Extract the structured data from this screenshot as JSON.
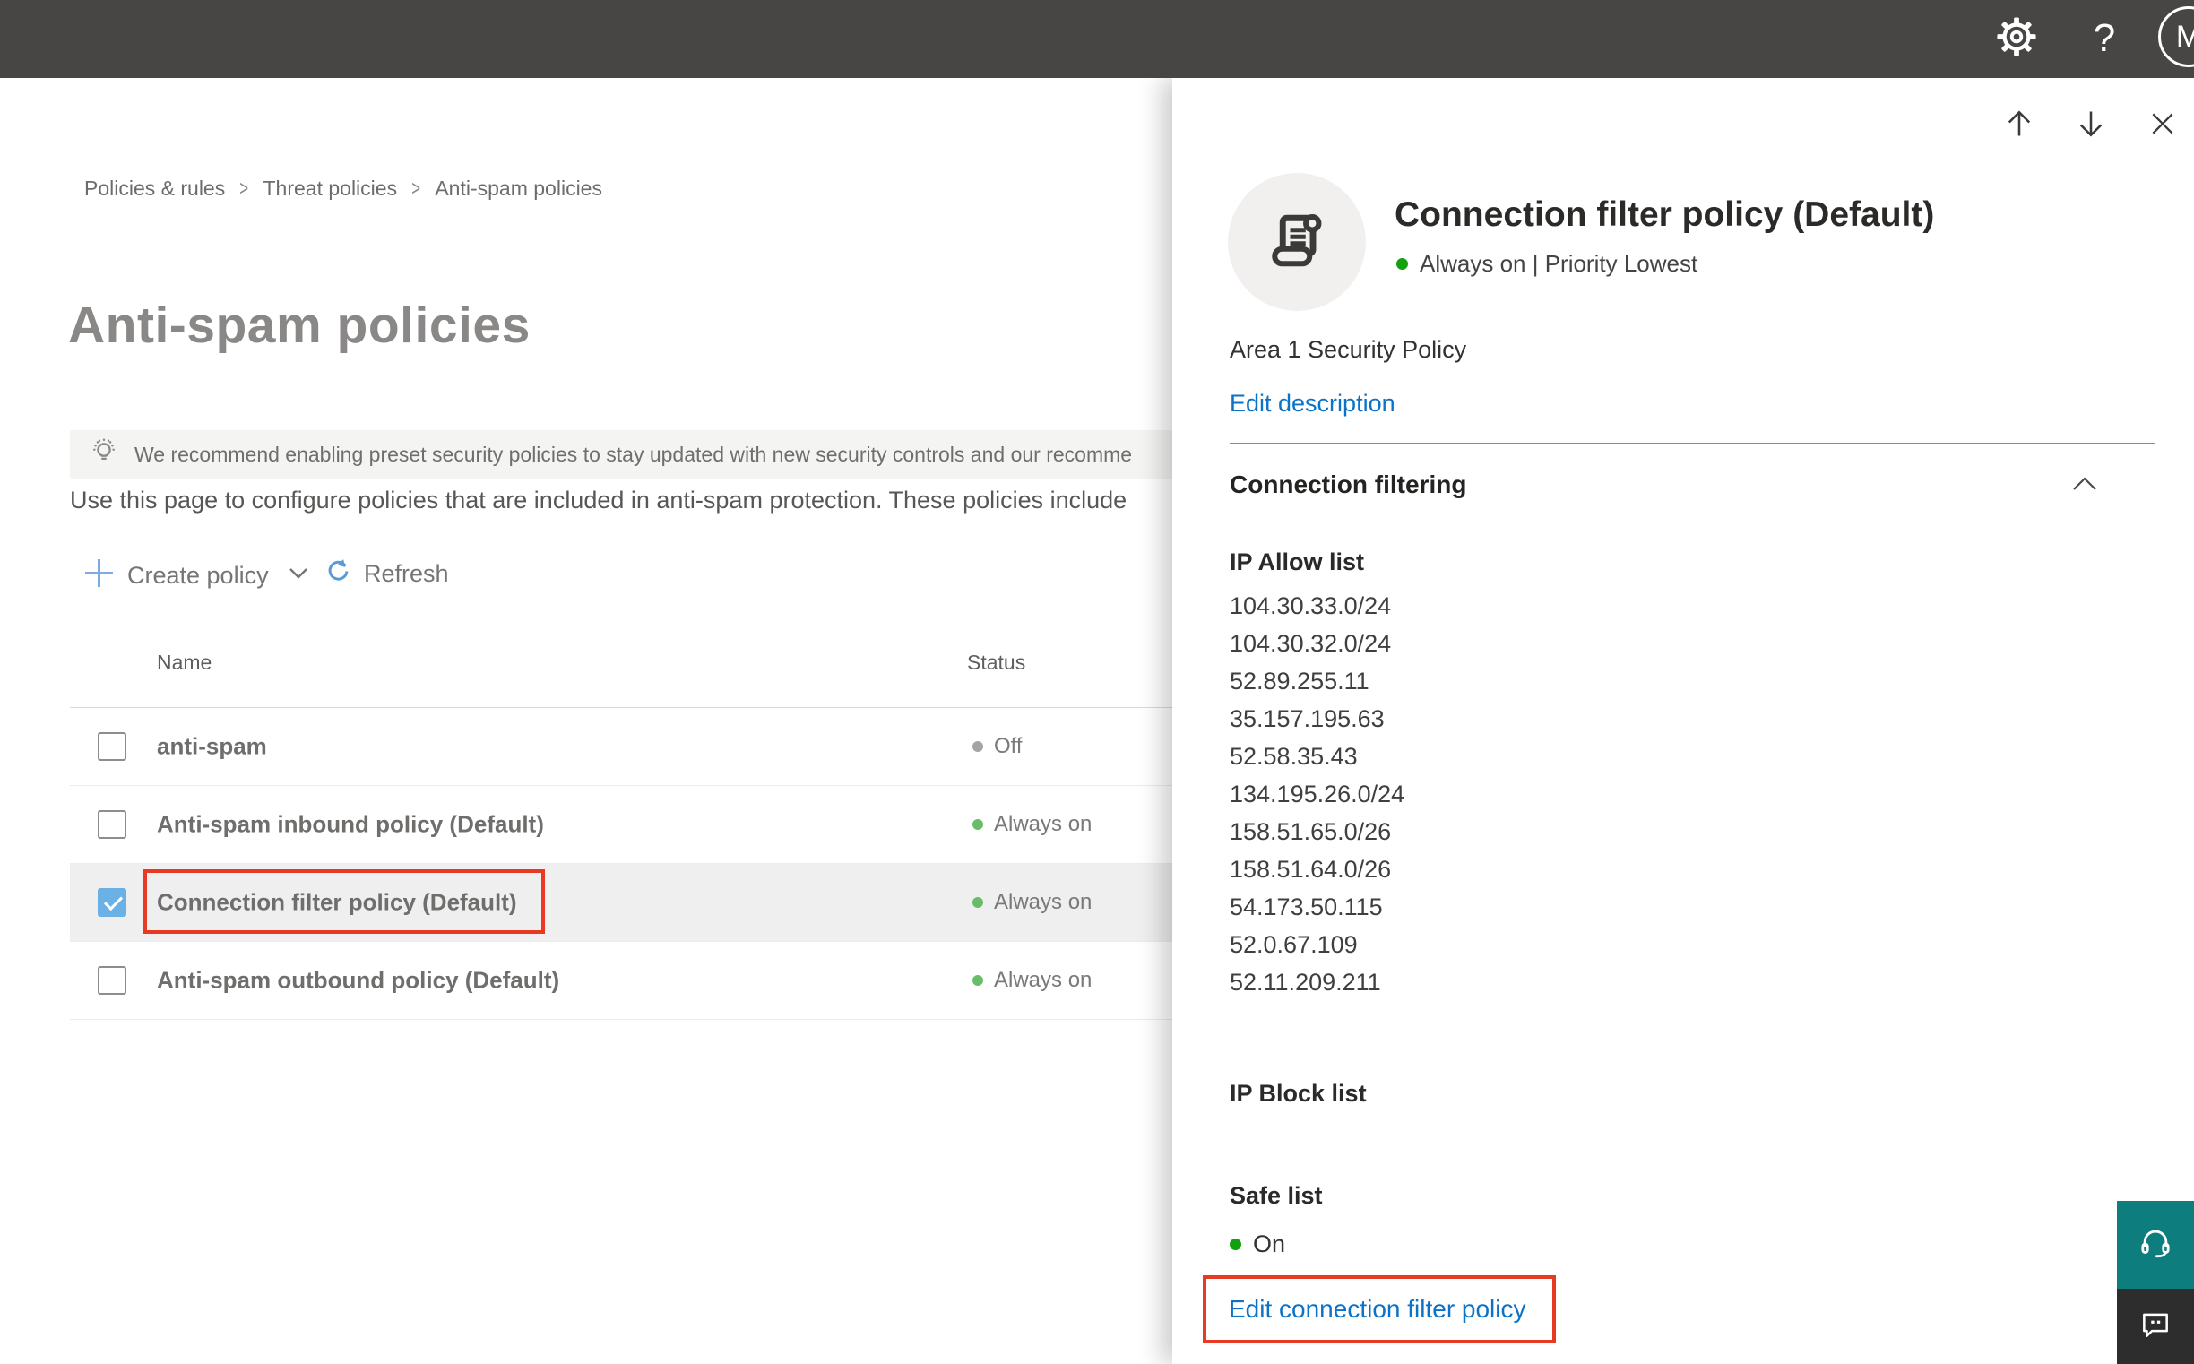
{
  "topbar": {
    "help_label": "?",
    "avatar_initial": "M"
  },
  "breadcrumb": {
    "separator": ">",
    "items": [
      "Policies & rules",
      "Threat policies",
      "Anti-spam policies"
    ]
  },
  "page": {
    "title": "Anti-spam policies",
    "banner_text": "We recommend enabling preset security policies to stay updated with new security controls and our recomme",
    "description": "Use this page to configure policies that are included in anti-spam protection. These policies include",
    "create_policy_label": "Create policy",
    "refresh_label": "Refresh"
  },
  "table": {
    "columns": [
      "Name",
      "Status"
    ],
    "rows": [
      {
        "name": "anti-spam",
        "status_label": "Off",
        "status": "off",
        "checked": false,
        "selected": false,
        "highlighted": false
      },
      {
        "name": "Anti-spam inbound policy (Default)",
        "status_label": "Always on",
        "status": "on",
        "checked": false,
        "selected": false,
        "highlighted": false
      },
      {
        "name": "Connection filter policy (Default)",
        "status_label": "Always on",
        "status": "on",
        "checked": true,
        "selected": true,
        "highlighted": true
      },
      {
        "name": "Anti-spam outbound policy (Default)",
        "status_label": "Always on",
        "status": "on",
        "checked": false,
        "selected": false,
        "highlighted": false
      }
    ]
  },
  "flyout": {
    "title": "Connection filter policy (Default)",
    "status_label": "Always on | Priority Lowest",
    "description": "Area 1 Security Policy",
    "edit_description_label": "Edit description",
    "section_title": "Connection filtering",
    "ip_allow_title": "IP Allow list",
    "ip_allow_list": [
      "104.30.33.0/24",
      "104.30.32.0/24",
      "52.89.255.11",
      "35.157.195.63",
      "52.58.35.43",
      "134.195.26.0/24",
      "158.51.65.0/26",
      "158.51.64.0/26",
      "54.173.50.115",
      "52.0.67.109",
      "52.11.209.211"
    ],
    "ip_block_title": "IP Block list",
    "safe_list_title": "Safe list",
    "safe_list_status_label": "On",
    "edit_policy_label": "Edit connection filter policy"
  },
  "colors": {
    "topbar_bg": "#484644",
    "accent_link": "#0b72c7",
    "highlight_red": "#e83a23",
    "checkbox_checked_blue": "#6cb1e6",
    "status_on_green": "#12a10e",
    "status_on_soft_green": "#67bd68",
    "status_off_gray": "#a5a4a2",
    "support_teal": "#0d7d7d",
    "feedback_dark": "#2d2d2d"
  }
}
